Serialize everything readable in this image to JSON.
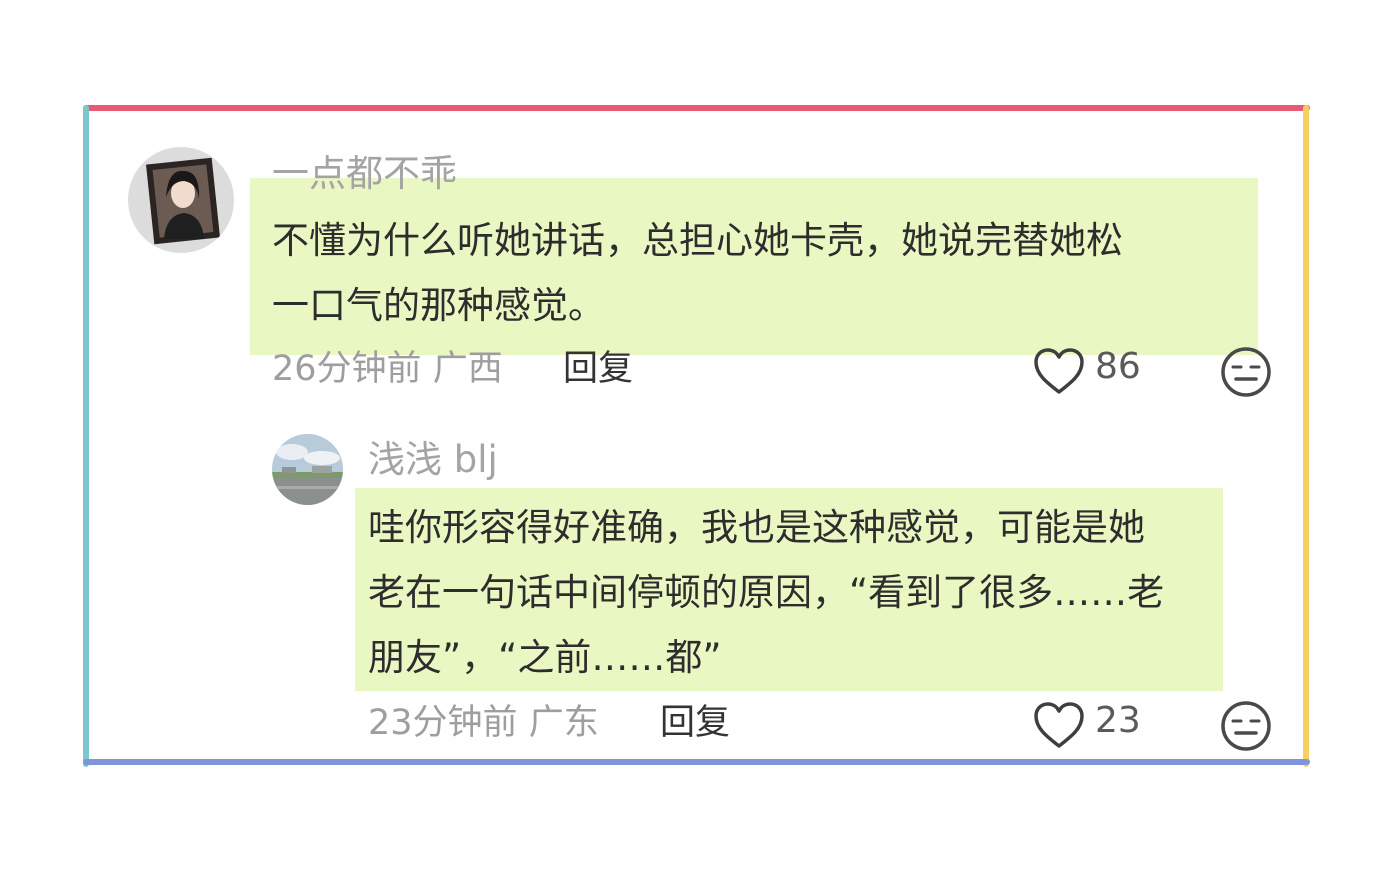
{
  "colors": {
    "border_top": "#e95a74",
    "border_left": "#7cc6cf",
    "border_right": "#f6cf61",
    "border_bottom": "#7f95d8",
    "highlight": "#e9f8c3"
  },
  "comments": [
    {
      "username": "一点都不乖",
      "text_lines": [
        "不懂为什么听她讲话，总担心她卡壳，她说完替她松",
        "一口气的那种感觉。"
      ],
      "time": "26分钟前",
      "location": "广西",
      "reply_label": "回复",
      "likes": "86",
      "avatar_icon": "user-avatar-portrait",
      "like_icon": "heart-outline-icon",
      "dislike_icon": "meh-face-icon"
    },
    {
      "username": "浅浅 blj",
      "text_lines": [
        "哇你形容得好准确，我也是这种感觉，可能是她",
        "老在一句话中间停顿的原因，“看到了很多……老",
        "朋友”，“之前……都”"
      ],
      "time": "23分钟前",
      "location": "广东",
      "reply_label": "回复",
      "likes": "23",
      "avatar_icon": "user-avatar-landscape",
      "like_icon": "heart-outline-icon",
      "dislike_icon": "meh-face-icon"
    }
  ]
}
